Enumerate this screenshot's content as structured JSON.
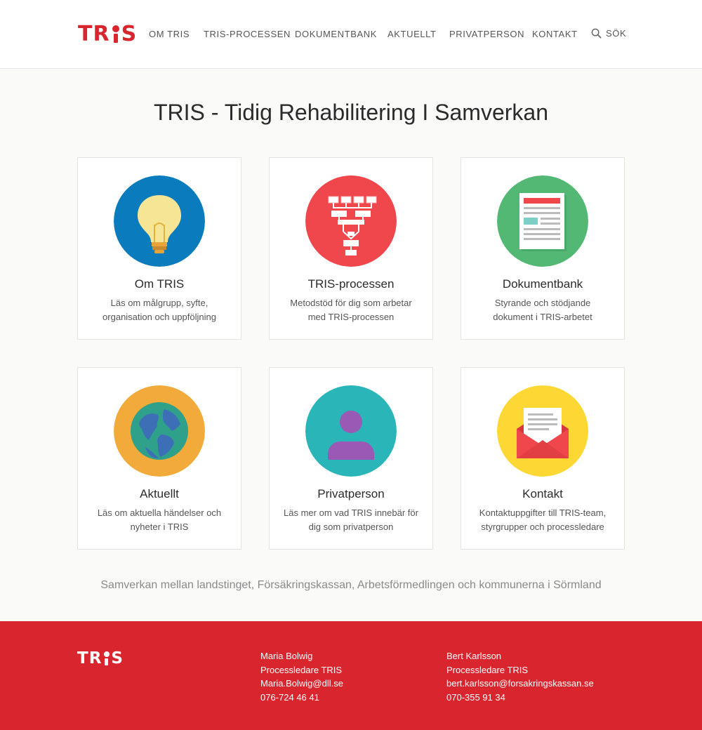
{
  "brand": {
    "logo_left": "TR",
    "logo_right": "S",
    "color": "#d9262e"
  },
  "nav": {
    "items": [
      "OM TRIS",
      "TRIS-PROCESSEN",
      "DOKUMENTBANK",
      "AKTUELLT",
      "PRIVATPERSON",
      "KONTAKT"
    ],
    "search_label": "SÖK",
    "search_icon": "search-icon"
  },
  "page": {
    "title": "TRIS - Tidig Rehabilitering I Samverkan",
    "tagline": "Samverkan mellan landstinget, Försäkringskassan, Arbetsförmedlingen och kommunerna i Sörmland"
  },
  "cards": [
    {
      "title": "Om TRIS",
      "desc": "Läs om målgrupp, syfte, organisation och uppföljning",
      "icon": "lightbulb-icon",
      "color": "#0a7bbd"
    },
    {
      "title": "TRIS-processen",
      "desc": "Metodstöd för dig som arbetar med TRIS-processen",
      "icon": "flowchart-icon",
      "color": "#f0474d"
    },
    {
      "title": "Dokumentbank",
      "desc": "Styrande och stödjande dokument i TRIS-arbetet",
      "icon": "document-icon",
      "color": "#52b874"
    },
    {
      "title": "Aktuellt",
      "desc": "Läs om aktuella händelser och nyheter i TRIS",
      "icon": "globe-icon",
      "color": "#f2ab3b"
    },
    {
      "title": "Privatperson",
      "desc": "Läs mer om vad TRIS innebär för dig som privatperson",
      "icon": "person-icon",
      "color": "#2ab5b8"
    },
    {
      "title": "Kontakt",
      "desc": "Kontaktuppgifter till TRIS-team, styrgrupper och processledare",
      "icon": "envelope-icon",
      "color": "#fdd835"
    }
  ],
  "footer": {
    "logo_left": "TR",
    "logo_right": "S",
    "contacts": [
      {
        "name": "Maria Bolwig",
        "role": "Processledare TRIS",
        "email": "Maria.Bolwig@dll.se",
        "phone": "076-724 46 41"
      },
      {
        "name": "Bert Karlsson",
        "role": "Processledare TRIS",
        "email": "bert.karlsson@forsakringskassan.se",
        "phone": "070-355 91 34"
      }
    ]
  }
}
